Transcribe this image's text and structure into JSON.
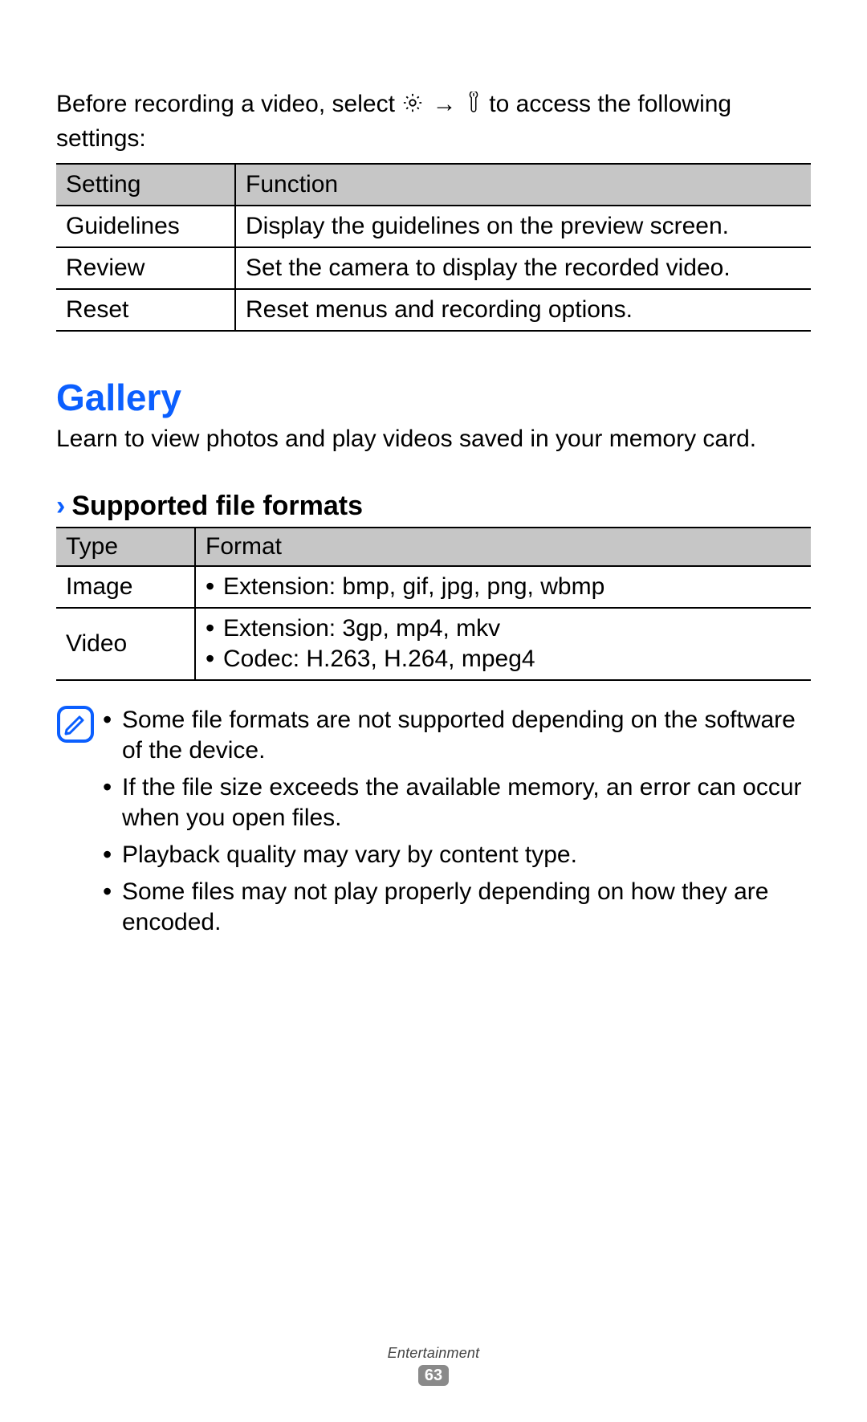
{
  "intro": {
    "text_before": "Before recording a video, select ",
    "text_middle": " to access the following settings:",
    "arrow": "→"
  },
  "settings_table": {
    "headers": {
      "col1": "Setting",
      "col2": "Function"
    },
    "rows": [
      {
        "name": "Guidelines",
        "desc": "Display the guidelines on the preview screen."
      },
      {
        "name": "Review",
        "desc": "Set the camera to display the recorded video."
      },
      {
        "name": "Reset",
        "desc": "Reset menus and recording options."
      }
    ]
  },
  "gallery": {
    "title": "Gallery",
    "lead": "Learn to view photos and play videos saved in your memory card.",
    "sub_heading": "Supported file formats"
  },
  "formats_table": {
    "headers": {
      "col1": "Type",
      "col2": "Format"
    },
    "rows": [
      {
        "type": "Image",
        "items": [
          "Extension: bmp, gif, jpg, png, wbmp"
        ]
      },
      {
        "type": "Video",
        "items": [
          "Extension: 3gp, mp4, mkv",
          "Codec: H.263, H.264, mpeg4"
        ]
      }
    ]
  },
  "notes": [
    "Some file formats are not supported depending on the software of the device.",
    "If the file size exceeds the available memory, an error can occur when you open files.",
    "Playback quality may vary by content type.",
    "Some files may not play properly depending on how they are encoded."
  ],
  "footer": {
    "category": "Entertainment",
    "page": "63"
  },
  "colors": {
    "accent": "#0b5fff"
  }
}
